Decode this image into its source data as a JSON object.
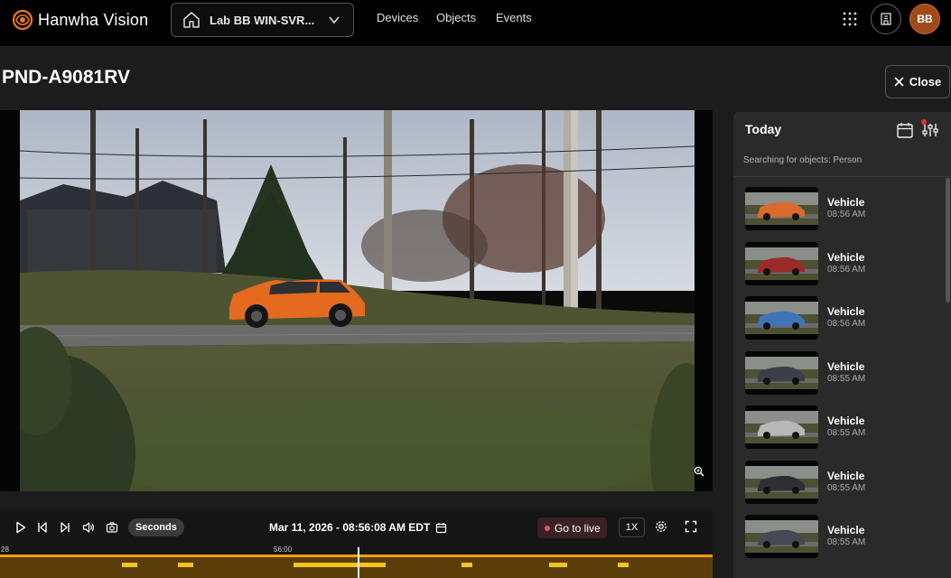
{
  "header": {
    "brand": "Hanwha Vision",
    "site": "Lab BB WIN-SVR...",
    "nav": [
      "Devices",
      "Objects",
      "Events"
    ],
    "user_initials": "BB"
  },
  "camera": {
    "title": "PND-A9081RV",
    "close_label": "Close"
  },
  "playback": {
    "step_unit": "Seconds",
    "datetime": "Mar 11, 2026 - 08:56:08 AM EDT",
    "live_label": "Go to live",
    "speed": "1X",
    "timeline_labels": [
      "28",
      "56:00"
    ]
  },
  "panel": {
    "title": "Today",
    "search_status": "Searching for objects: Person",
    "items": [
      {
        "type": "Vehicle",
        "time": "08:56 AM",
        "color": "#d96a2b"
      },
      {
        "type": "Vehicle",
        "time": "08:56 AM",
        "color": "#9b2a2a"
      },
      {
        "type": "Vehicle",
        "time": "08:56 AM",
        "color": "#3f74b8"
      },
      {
        "type": "Vehicle",
        "time": "08:55 AM",
        "color": "#3c3f4a"
      },
      {
        "type": "Vehicle",
        "time": "08:55 AM",
        "color": "#b8b8b8"
      },
      {
        "type": "Vehicle",
        "time": "08:55 AM",
        "color": "#2e2f34"
      },
      {
        "type": "Vehicle",
        "time": "08:55 AM",
        "color": "#474a55"
      }
    ]
  },
  "colors": {
    "accent": "#f29f05",
    "live": "#e0565f",
    "avatar": "#a04a1b"
  }
}
